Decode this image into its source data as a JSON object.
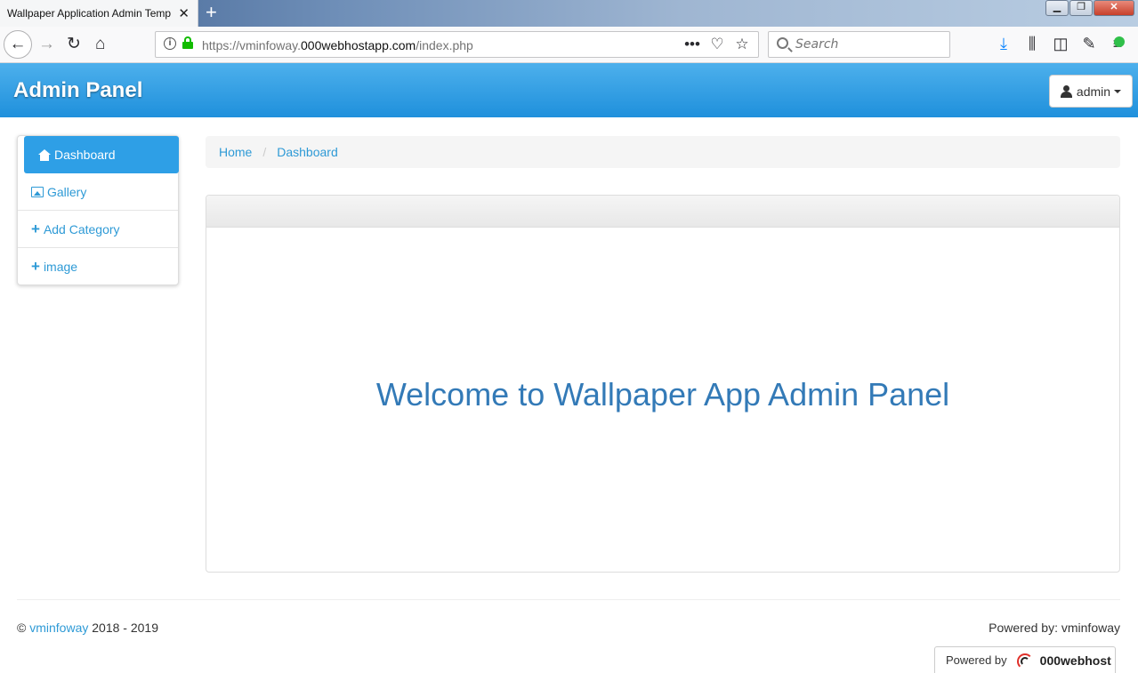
{
  "browser": {
    "tab_title": "Wallpaper Application Admin Temp",
    "url_prefix": "https://vminfoway.",
    "url_domain": "000webhostapp.com",
    "url_path": "/index.php",
    "search_placeholder": "Search"
  },
  "header": {
    "brand": "Admin Panel",
    "user_label": "admin"
  },
  "sidebar": {
    "items": [
      {
        "label": "Dashboard",
        "icon": "home-icon",
        "active": true
      },
      {
        "label": "Gallery",
        "icon": "picture-icon"
      },
      {
        "label": "Add Category",
        "icon": "plus-icon"
      },
      {
        "label": "image",
        "icon": "plus-icon"
      }
    ]
  },
  "breadcrumb": {
    "home": "Home",
    "current": "Dashboard"
  },
  "main": {
    "welcome": "Welcome to Wallpaper App Admin Panel"
  },
  "footer": {
    "copyright_symbol": "©",
    "company": "vminfoway",
    "years": "2018 - 2019",
    "powered_by": "Powered by: vminfoway",
    "badge_prefix": "Powered by",
    "badge_host": "000webhost"
  },
  "colors": {
    "header_top": "#4db0ec",
    "header_bottom": "#1f90dc",
    "link": "#2e9ad6",
    "welcome": "#337ab7",
    "active_item": "#2e9fe6"
  }
}
